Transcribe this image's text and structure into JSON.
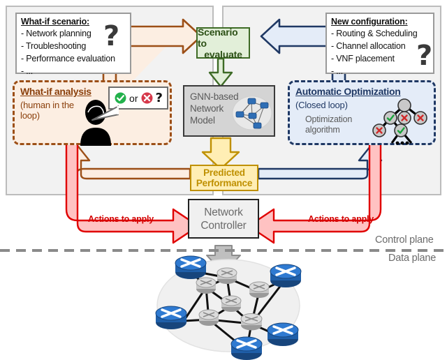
{
  "panels": {
    "left_panel": "what-if-panel",
    "right_panel": "automatic-optimization-panel"
  },
  "whatif_scenario": {
    "title": "What-if scenario:",
    "items": [
      "- Network planning",
      "- Troubleshooting",
      "- Performance evaluation",
      "- ..."
    ],
    "icon": "question-mark"
  },
  "new_configuration": {
    "title": "New configuration:",
    "items": [
      "- Routing & Scheduling",
      "- Channel allocation",
      "- VNF placement",
      "- ..."
    ],
    "icon": "question-mark"
  },
  "center": {
    "scenario": {
      "line1": "Scenario to",
      "line2": "evaluate"
    },
    "gnn": {
      "line1": "GNN-based",
      "line2": "Network",
      "line3": "Model",
      "icon": "network-topology-icon"
    },
    "predicted": {
      "line1": "Predicted",
      "line2": "Performance"
    },
    "controller": {
      "line1": "Network",
      "line2": "Controller"
    }
  },
  "whatif_analysis": {
    "heading": "What-if analysis",
    "subtitle_line1": "(human in the",
    "subtitle_line2": "loop)",
    "avatar": "human-operator-icon",
    "bubble": {
      "check": "check-circle-icon",
      "or": "or",
      "cross": "cross-circle-icon",
      "question": "?"
    }
  },
  "automatic_optimization": {
    "heading": "Automatic Optimization",
    "subtitle": "(Closed loop)",
    "algorithm_line1": "Optimization",
    "algorithm_line2": "algorithm",
    "tree_icon": "search-tree-icon",
    "tree_ellipsis": "..."
  },
  "actions": {
    "left_label": "Actions to apply",
    "right_label": "Actions to apply"
  },
  "planes": {
    "control": "Control plane",
    "data": "Data plane"
  },
  "network": {
    "icon": "network-topology-diagram",
    "edge_routers": 5,
    "core_routers": 6
  },
  "colors": {
    "green_box_fill": "#e2efd9",
    "green_box_border": "#3e6b26",
    "yellow_box_fill": "#ffeeb4",
    "yellow_box_border": "#bf9000",
    "orange_accent": "#9c4f17",
    "orange_fill": "#fceee2",
    "blue_accent": "#1f3864",
    "blue_fill": "#e4ecf8",
    "red_accent": "#d40000",
    "red_fill": "#ffc2c2",
    "gray_panel": "#f2f2f2",
    "gnn_fill": "#d4d4d4",
    "router_blue": "#1f5fa9",
    "router_gray": "#c9c9c9"
  }
}
